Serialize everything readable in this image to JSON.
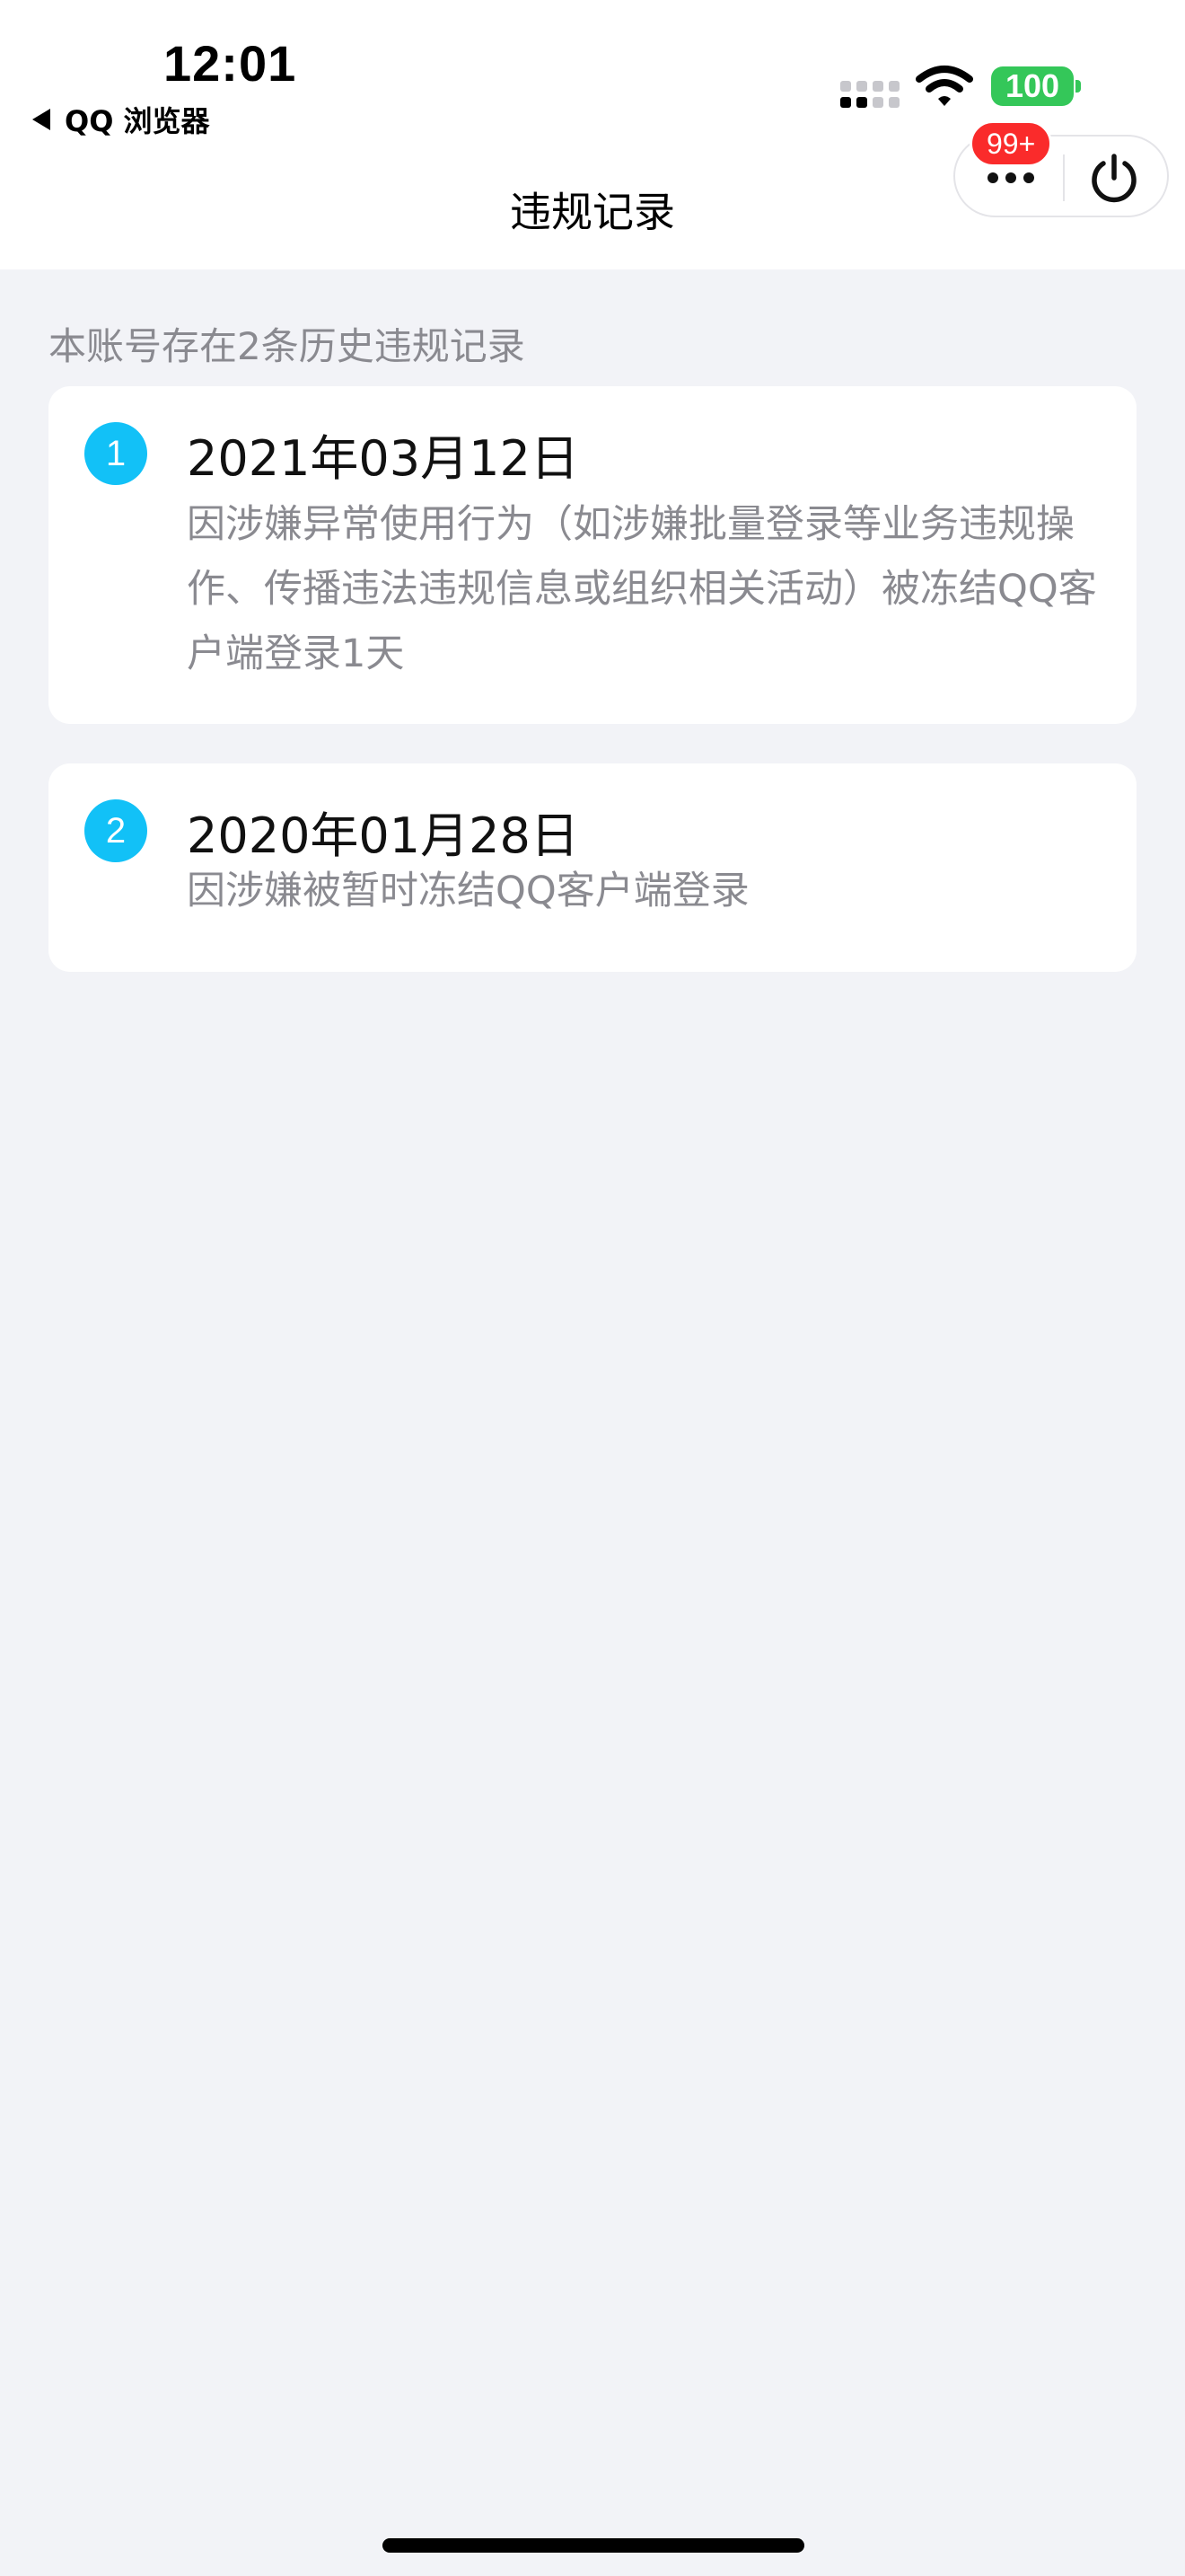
{
  "status_bar": {
    "time": "12:01",
    "back_app": "QQ 浏览器",
    "battery": "100"
  },
  "nav": {
    "title": "违规记录",
    "badge": "99+"
  },
  "summary": "本账号存在2条历史违规记录",
  "records": [
    {
      "index": "1",
      "date": "2021年03月12日",
      "description": "因涉嫌异常使用行为（如涉嫌批量登录等业务违规操作、传播违法违规信息或组织相关活动）被冻结QQ客户端登录1天"
    },
    {
      "index": "2",
      "date": "2020年01月28日",
      "description": "因涉嫌被暂时冻结QQ客户端登录"
    }
  ],
  "colors": {
    "accent": "#12c1f7",
    "badge": "#fa2b2b",
    "battery": "#34c759",
    "background": "#f2f3f7"
  },
  "icons": [
    "back-triangle-icon",
    "signal-icon",
    "wifi-icon",
    "battery-icon",
    "more-dots-icon",
    "power-icon"
  ]
}
